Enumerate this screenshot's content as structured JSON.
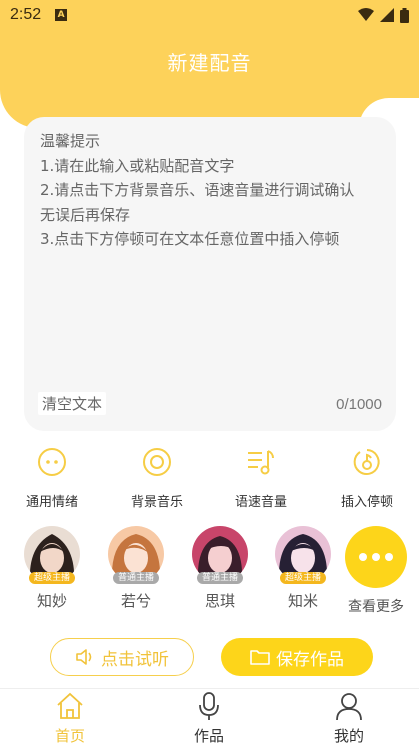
{
  "status_bar": {
    "time": "2:52",
    "notif_icon_letter": "A"
  },
  "header": {
    "title": "新建配音"
  },
  "editor": {
    "hint_lines": [
      "温馨提示",
      "1.请在此输入或粘贴配音文字",
      "2.请点击下方背景音乐、语速音量进行调试确认",
      "无误后再保存",
      "3.点击下方停顿可在文本任意位置中插入停顿"
    ],
    "clear_label": "清空文本",
    "counter": "0/1000"
  },
  "tools": [
    {
      "label": "通用情绪",
      "icon": "emotion-icon"
    },
    {
      "label": "背景音乐",
      "icon": "music-disc-icon"
    },
    {
      "label": "语速音量",
      "icon": "speed-volume-icon"
    },
    {
      "label": "插入停顿",
      "icon": "pause-icon"
    }
  ],
  "voices": [
    {
      "name": "知妙",
      "badge": "超级主播",
      "badge_type": "super"
    },
    {
      "name": "若兮",
      "badge": "普通主播",
      "badge_type": "normal"
    },
    {
      "name": "思琪",
      "badge": "普通主播",
      "badge_type": "normal"
    },
    {
      "name": "知米",
      "badge": "超级主播",
      "badge_type": "super"
    }
  ],
  "more_label": "查看更多",
  "actions": {
    "listen_label": "点击试听",
    "save_label": "保存作品"
  },
  "nav": [
    {
      "label": "首页",
      "icon": "home-icon",
      "active": true
    },
    {
      "label": "作品",
      "icon": "microphone-icon",
      "active": false
    },
    {
      "label": "我的",
      "icon": "profile-icon",
      "active": false
    }
  ],
  "colors": {
    "accent": "#fdd25a",
    "accent_strong": "#fdd51a",
    "accent_text": "#f1c33a"
  }
}
